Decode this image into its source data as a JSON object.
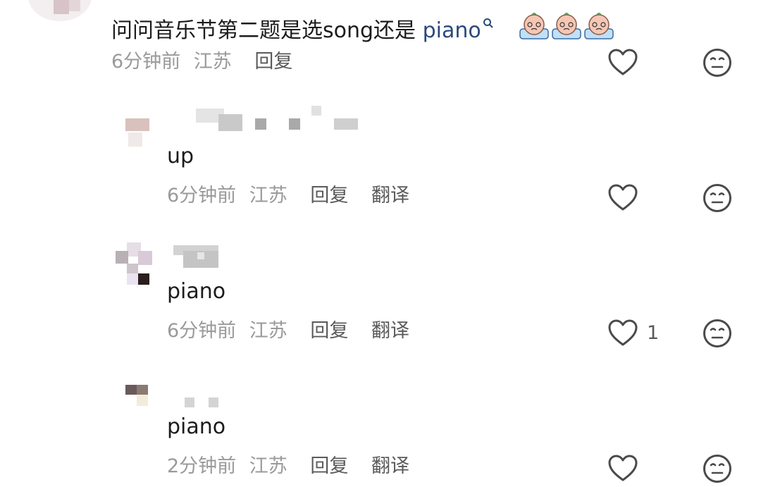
{
  "comments": [
    {
      "text_prefix": "问问音乐节第二题是选song还是",
      "text_link": "piano",
      "meta_time": "6分钟前",
      "meta_region": "江苏",
      "reply_label": "回复"
    },
    {
      "text": "up",
      "meta_time": "6分钟前",
      "meta_region": "江苏",
      "reply_label": "回复",
      "translate_label": "翻译"
    },
    {
      "text": "piano",
      "meta_time": "6分钟前",
      "meta_region": "江苏",
      "reply_label": "回复",
      "translate_label": "翻译",
      "like_count": "1"
    },
    {
      "text": "piano",
      "meta_time": "2分钟前",
      "meta_region": "江苏",
      "reply_label": "回复",
      "translate_label": "翻译"
    }
  ],
  "icons": {
    "like": "heart-outline-icon",
    "dislike": "neutral-face-icon",
    "search": "search-icon",
    "emoji": "crying-peach-emoji"
  },
  "colors": {
    "text": "#1c1c1c",
    "meta": "#9a9a9a",
    "action": "#5a5a5a",
    "link": "#2b4a7a",
    "icon": "#4a4a4a"
  }
}
